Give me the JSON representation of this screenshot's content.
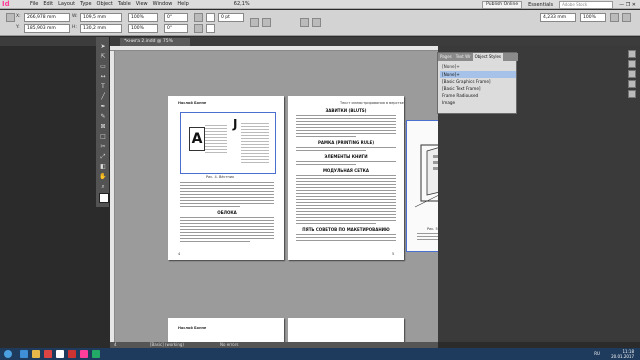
{
  "app": {
    "logo": "Id",
    "menu": [
      "File",
      "Edit",
      "Layout",
      "Type",
      "Object",
      "Table",
      "View",
      "Window",
      "Help"
    ],
    "zoom": "62,1%",
    "publish_online": "Publish Online",
    "workspace": "Essentials",
    "search_placeholder": "Adobe Stock"
  },
  "control": {
    "x_label": "X:",
    "x_value": "266,978 mm",
    "y_label": "Y:",
    "y_value": "185,903 mm",
    "w_label": "W:",
    "w_value": "109,5 mm",
    "h_label": "H:",
    "h_value": "130,2 mm",
    "zoom1": "100%",
    "zoom2": "100%",
    "angle1": "0°",
    "angle2": "0°",
    "stroke": "0 pt",
    "width_field": "4,233 mm",
    "pct": "100%"
  },
  "document": {
    "tab_title": "*книга 2.indd @ 75%"
  },
  "pages": {
    "left_header": "Наслой Бонне",
    "left_caption": "Рис. 4. Вёстник",
    "left_heading": "ОБЛОКА",
    "right_header": "Текст иллюстрирования в верстке",
    "right_h1": "ЗАВИТКИ (BLUTS)",
    "right_h2": "РАМКА (PRINTING RULE)",
    "right_h3": "ЭЛЕМЕНТЫ КНИГИ",
    "right_h4": "МОДУЛЬНАЯ СЕТКА",
    "right_h5": "ПЯТЬ СОВЕТОВ ПО МАКЕТИРОВАНИЮ",
    "right_caption": "Рис. 5. Вёстник",
    "page_num_left": "4",
    "page_num_right": "5",
    "lower_header": "Наслой Бонне"
  },
  "panel": {
    "tabs": [
      "Pages",
      "Text Wr",
      "Object Styles"
    ],
    "active_tab": "Object Styles",
    "current": "[None]+",
    "items": [
      "[None]+",
      "[Basic Graphics Frame]",
      "[Basic Text Frame]",
      "Frame Radioused",
      "Image"
    ]
  },
  "status": {
    "page": "4",
    "state": "[Basic] (working)",
    "errors": "No errors"
  },
  "taskbar": {
    "time": "11:18",
    "date": "20.01.2017",
    "lang": "RU"
  },
  "colors": {
    "accent": "#ff3d9a",
    "selection": "#a7c2e8",
    "frame": "#4a6fd1"
  }
}
